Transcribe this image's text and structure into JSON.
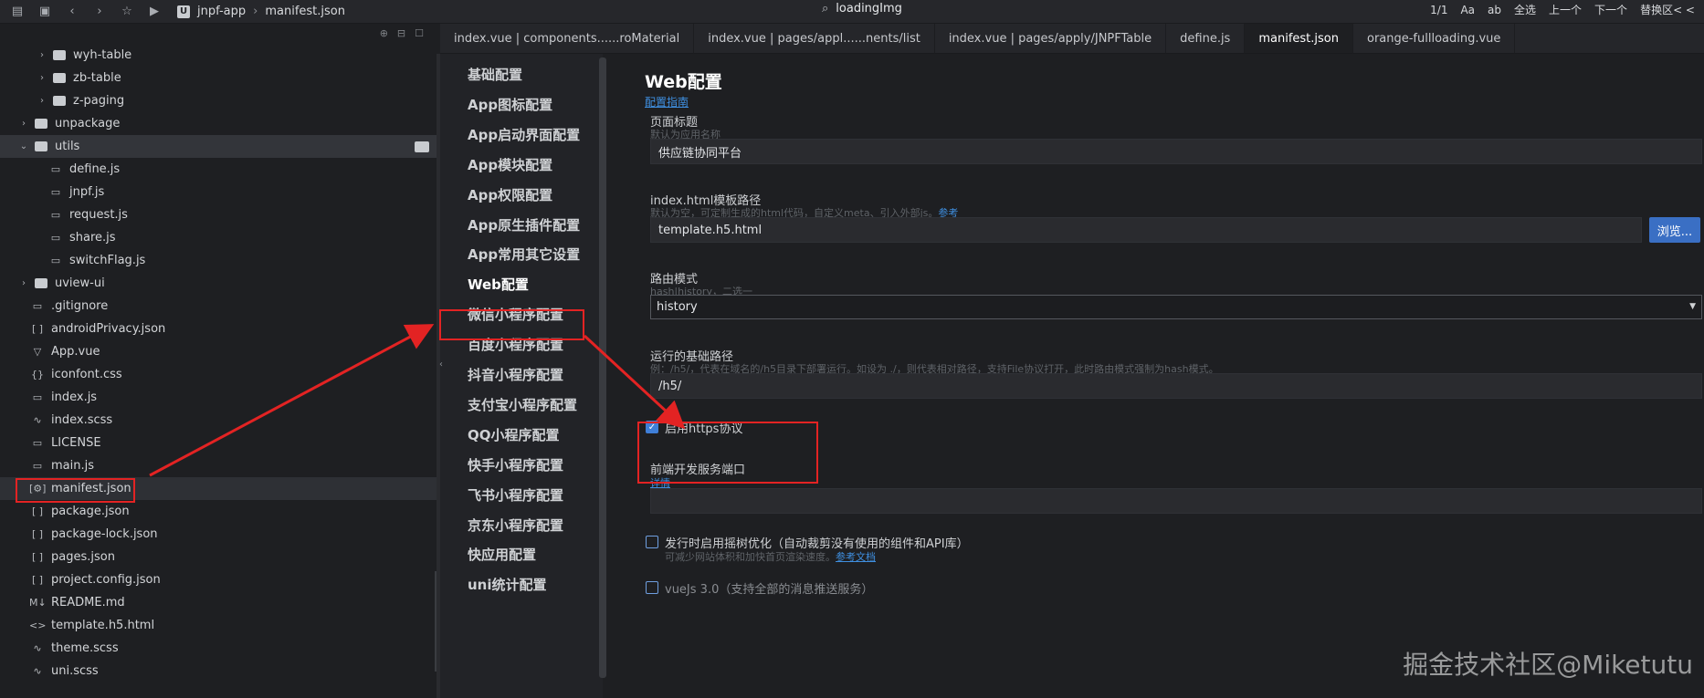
{
  "topbar": {
    "crumb_app": "jnpf-app",
    "crumb_file": "manifest.json",
    "search_text": "loadingImg",
    "find_count": "1/1",
    "find_case": "Aa",
    "find_word": "ab",
    "find_select_all": "全选",
    "find_prev": "上一个",
    "find_next": "下一个",
    "find_replace": "替换区< <"
  },
  "sidebar": {
    "items": [
      {
        "label": "wyh-table",
        "icon": "folder-icon",
        "indent": 2,
        "chevron": "right"
      },
      {
        "label": "zb-table",
        "icon": "folder-icon",
        "indent": 2,
        "chevron": "right"
      },
      {
        "label": "z-paging",
        "icon": "folder-icon",
        "indent": 2,
        "chevron": "right"
      },
      {
        "label": "unpackage",
        "icon": "folder-icon",
        "indent": 1,
        "chevron": "right"
      },
      {
        "label": "utils",
        "icon": "folder-open-icon",
        "indent": 1,
        "chevron": "down"
      },
      {
        "label": "define.js",
        "icon": "js-file-icon",
        "indent": 2,
        "chevron": ""
      },
      {
        "label": "jnpf.js",
        "icon": "js-file-icon",
        "indent": 2,
        "chevron": ""
      },
      {
        "label": "request.js",
        "icon": "js-file-icon",
        "indent": 2,
        "chevron": ""
      },
      {
        "label": "share.js",
        "icon": "js-file-icon",
        "indent": 2,
        "chevron": ""
      },
      {
        "label": "switchFlag.js",
        "icon": "js-file-icon",
        "indent": 2,
        "chevron": ""
      },
      {
        "label": "uview-ui",
        "icon": "folder-icon",
        "indent": 1,
        "chevron": "right"
      },
      {
        "label": ".gitignore",
        "icon": "file-icon",
        "indent": 1,
        "chevron": ""
      },
      {
        "label": "androidPrivacy.json",
        "icon": "json-file-icon",
        "indent": 1,
        "chevron": ""
      },
      {
        "label": "App.vue",
        "icon": "vue-file-icon",
        "indent": 1,
        "chevron": ""
      },
      {
        "label": "iconfont.css",
        "icon": "css-file-icon",
        "indent": 1,
        "chevron": ""
      },
      {
        "label": "index.js",
        "icon": "js-file-icon",
        "indent": 1,
        "chevron": ""
      },
      {
        "label": "index.scss",
        "icon": "scss-file-icon",
        "indent": 1,
        "chevron": ""
      },
      {
        "label": "LICENSE",
        "icon": "file-icon",
        "indent": 1,
        "chevron": ""
      },
      {
        "label": "main.js",
        "icon": "js-file-icon",
        "indent": 1,
        "chevron": ""
      },
      {
        "label": "manifest.json",
        "icon": "manifest-file-icon",
        "indent": 1,
        "chevron": ""
      },
      {
        "label": "package.json",
        "icon": "json-file-icon",
        "indent": 1,
        "chevron": ""
      },
      {
        "label": "package-lock.json",
        "icon": "json-file-icon",
        "indent": 1,
        "chevron": ""
      },
      {
        "label": "pages.json",
        "icon": "json-file-icon",
        "indent": 1,
        "chevron": ""
      },
      {
        "label": "project.config.json",
        "icon": "json-file-icon",
        "indent": 1,
        "chevron": ""
      },
      {
        "label": "README.md",
        "icon": "markdown-file-icon",
        "indent": 1,
        "chevron": ""
      },
      {
        "label": "template.h5.html",
        "icon": "html-file-icon",
        "indent": 1,
        "chevron": ""
      },
      {
        "label": "theme.scss",
        "icon": "scss-file-icon",
        "indent": 1,
        "chevron": ""
      },
      {
        "label": "uni.scss",
        "icon": "scss-file-icon",
        "indent": 1,
        "chevron": ""
      }
    ]
  },
  "tabs": [
    {
      "label": "index.vue | components......roMaterial"
    },
    {
      "label": "index.vue | pages/appl......nents/list"
    },
    {
      "label": "index.vue | pages/apply/JNPFTable"
    },
    {
      "label": "define.js"
    },
    {
      "label": "manifest.json"
    },
    {
      "label": "orange-fullloading.vue"
    }
  ],
  "nav": [
    "基础配置",
    "App图标配置",
    "App启动界面配置",
    "App模块配置",
    "App权限配置",
    "App原生插件配置",
    "App常用其它设置",
    "Web配置",
    "微信小程序配置",
    "百度小程序配置",
    "抖音小程序配置",
    "支付宝小程序配置",
    "QQ小程序配置",
    "快手小程序配置",
    "飞书小程序配置",
    "京东小程序配置",
    "快应用配置",
    "uni统计配置"
  ],
  "content": {
    "title": "Web配置",
    "guide_link": "配置指南",
    "page_title_label": "页面标题",
    "page_title_hint": "默认为应用名称",
    "page_title_value": "供应链协同平台",
    "template_label": "index.html模板路径",
    "template_hint": "默认为空，可定制生成的html代码，自定义meta、引入外部js。",
    "template_hint_link": "参考",
    "template_value": "template.h5.html",
    "browse_label": "浏览...",
    "router_label": "路由模式",
    "router_hint": "hash|history，二选一",
    "router_value": "history",
    "base_label": "运行的基础路径",
    "base_hint": "例：/h5/，代表在域名的/h5目录下部署运行。如设为 ./，则代表相对路径，支持File协议打开，此时路由模式强制为hash模式。",
    "base_value": "/h5/",
    "https_label": "启用https协议",
    "devport_label": "前端开发服务端口",
    "devport_link": "详情",
    "devport_value": "",
    "treeshake_label": "发行时启用摇树优化（自动裁剪没有使用的组件和API库）",
    "treeshake_hint": "可减少网站体积和加快首页渲染速度。",
    "treeshake_link": "参考文档",
    "cut_label": "vueJs 3.0（支持全部的消息推送服务）"
  },
  "watermark": "掘金技术社区@Miketutu",
  "colors": {
    "annotation": "#e32323",
    "link": "#3f8fe0",
    "accent": "#3a6fc4"
  }
}
